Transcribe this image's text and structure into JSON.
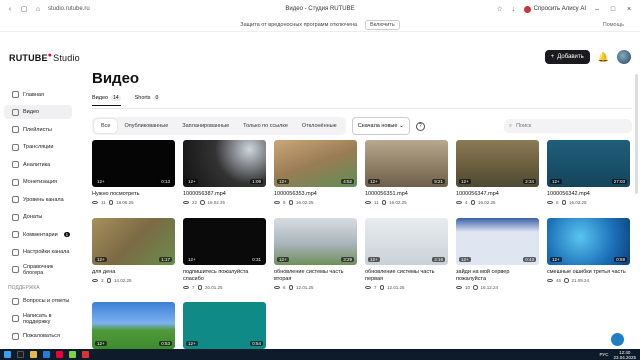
{
  "browser": {
    "url": "studio.rutube.ru",
    "tab_title": "Видео - Студия RUTUBE",
    "ask_alice": "Спросить Алису AI",
    "infobar_text": "Защита от вредоносных программ отключена",
    "infobar_enable": "Включить",
    "infobar_help": "Помощь"
  },
  "header": {
    "logo_main": "RUTUBE",
    "logo_studio": "Studio",
    "add_label": "Добавить"
  },
  "sidebar": {
    "items": [
      {
        "label": "Главная",
        "active": false
      },
      {
        "label": "Видео",
        "active": true
      },
      {
        "label": "Плейлисты",
        "active": false
      },
      {
        "label": "Трансляции",
        "active": false
      },
      {
        "label": "Аналитика",
        "active": false
      },
      {
        "label": "Монетизация",
        "active": false
      },
      {
        "label": "Уровень канала",
        "active": false
      },
      {
        "label": "Донаты",
        "active": false
      },
      {
        "label": "Комментарии",
        "active": false,
        "badge": "1"
      },
      {
        "label": "Настройки канала",
        "active": false
      },
      {
        "label": "Справочник блогера",
        "active": false
      }
    ],
    "support_header": "Поддержка",
    "support_items": [
      {
        "label": "Вопросы и ответы"
      },
      {
        "label": "Написать в поддержку"
      },
      {
        "label": "Пожаловаться"
      }
    ]
  },
  "main": {
    "title": "Видео",
    "tabs": [
      {
        "label": "Видео",
        "count": "14"
      },
      {
        "label": "Shorts",
        "count": "0"
      }
    ],
    "filters": [
      "Все",
      "Опубликованные",
      "Запланированные",
      "Только по ссылке",
      "Отклонённые"
    ],
    "sort_label": "Сначала новые",
    "search_placeholder": "Поиск"
  },
  "videos": [
    {
      "title": "Нужно посмотреть",
      "views": "11",
      "date": "18.06.25",
      "age": "12+",
      "duration": "0:13"
    },
    {
      "title": "1000056387.mp4",
      "views": "22",
      "date": "16.02.25",
      "age": "12+",
      "duration": "1:09"
    },
    {
      "title": "1000056353.mp4",
      "views": "9",
      "date": "16.02.25",
      "age": "12+",
      "duration": "4:52"
    },
    {
      "title": "1000056351.mp4",
      "views": "11",
      "date": "16.02.25",
      "age": "12+",
      "duration": "9:21"
    },
    {
      "title": "1000056347.mp4",
      "views": "4",
      "date": "16.02.25",
      "age": "12+",
      "duration": "2:34"
    },
    {
      "title": "1000056342.mp4",
      "views": "6",
      "date": "16.02.25",
      "age": "12+",
      "duration": "27:03"
    },
    {
      "title": "для дена",
      "views": "3",
      "date": "14.02.25",
      "age": "12+",
      "duration": "1:17"
    },
    {
      "title": "подпишитесь пожалуйста спасибо",
      "views": "7",
      "date": "20.01.25",
      "age": "12+",
      "duration": "0:31"
    },
    {
      "title": "обновление системы часть вторая",
      "views": "6",
      "date": "12.01.25",
      "age": "12+",
      "duration": "3:29"
    },
    {
      "title": "обновление системы часть первая",
      "views": "7",
      "date": "12.01.25",
      "age": "12+",
      "duration": "3:18"
    },
    {
      "title": "зайди на мой сервер пожалуйста",
      "views": "10",
      "date": "16.12.24",
      "age": "12+",
      "duration": "0:43"
    },
    {
      "title": "смешные ошибки третья часть",
      "views": "45",
      "date": "21.09.24",
      "age": "12+",
      "duration": "0:59"
    },
    {
      "title": "",
      "views": "",
      "date": "",
      "age": "12+",
      "duration": "0:53"
    },
    {
      "title": "",
      "views": "",
      "date": "",
      "age": "12+",
      "duration": "0:54"
    }
  ],
  "taskbar": {
    "lang": "РУС",
    "time": "12:40",
    "date": "23.04.2025"
  }
}
